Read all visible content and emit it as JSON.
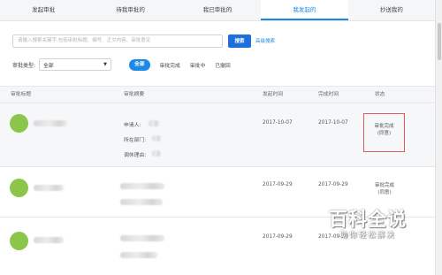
{
  "tabs": [
    {
      "label": "发起审批",
      "active": false
    },
    {
      "label": "待我审批的",
      "active": false
    },
    {
      "label": "我已审批的",
      "active": false
    },
    {
      "label": "我发起的",
      "active": true
    },
    {
      "label": "抄送我的",
      "active": false
    }
  ],
  "search": {
    "placeholder": "请输入搜索关键字,包括审批标题、编号、正文内容、审批意见",
    "value": "",
    "button_label": "搜索",
    "advanced_label": "高级搜索"
  },
  "filter": {
    "type_label": "审批类型:",
    "type_value": "全部",
    "status_chips": [
      {
        "label": "全部",
        "active": true
      },
      {
        "label": "审批完成",
        "active": false
      },
      {
        "label": "审批中",
        "active": false
      },
      {
        "label": "已撤回",
        "active": false
      }
    ]
  },
  "table": {
    "headers": {
      "title": "审批标题",
      "summary": "审批摘要",
      "start_time": "发起时间",
      "end_time": "完成时间",
      "status": "状态"
    },
    "rows": [
      {
        "summary_lines": [
          "申请人:",
          "所在部门:",
          "调休理由:"
        ],
        "start_time": "2017-10-07",
        "end_time": "2017-10-07",
        "status_line1": "审批完成",
        "status_line2": "(同意)",
        "highlighted": true
      },
      {
        "summary_lines": [],
        "start_time": "2017-09-29",
        "end_time": "2017-09-29",
        "status_line1": "审批完成",
        "status_line2": "(同意)",
        "highlighted": false
      },
      {
        "summary_lines": [],
        "start_time": "2017-09-29",
        "end_time": "2017-09-29",
        "status_line1": "",
        "status_line2": "",
        "highlighted": false
      }
    ]
  },
  "watermark": {
    "title": "百科全说",
    "subtitle": "助你轻松解决"
  },
  "colors": {
    "accent": "#1e88e5",
    "search_button": "#1e6fd9",
    "avatar": "#8bc54a",
    "status_box_border": "#e45a5a"
  }
}
